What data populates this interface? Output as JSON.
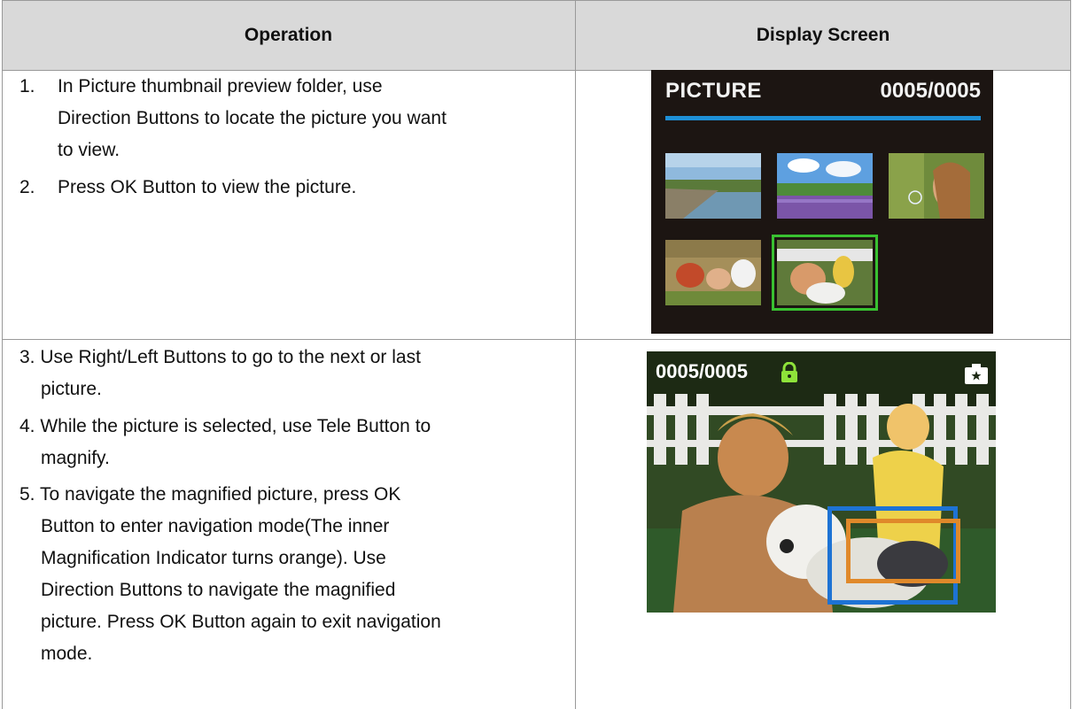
{
  "table": {
    "headers": {
      "operation": "Operation",
      "display": "Display Screen"
    },
    "row1": {
      "steps": [
        {
          "num": "1.",
          "lines": [
            "In Picture thumbnail preview folder, use",
            "Direction Buttons to locate the picture you want",
            "to view."
          ]
        },
        {
          "num": "2.",
          "lines": [
            "Press OK Button to view the picture."
          ]
        }
      ]
    },
    "row2": {
      "steps": [
        {
          "lines": [
            "3. Use Right/Left Buttons to go to the next or last",
            "picture."
          ]
        },
        {
          "lines": [
            "4. While the picture is selected, use Tele Button to",
            "magnify."
          ]
        },
        {
          "lines": [
            "5. To navigate the magnified picture, press OK",
            "Button to enter navigation mode(The inner",
            "Magnification Indicator turns orange). Use",
            "Direction Buttons to navigate the magnified",
            "picture. Press OK Button again to exit navigation",
            "mode."
          ]
        }
      ]
    }
  },
  "screen1": {
    "title": "PICTURE",
    "counter": "0005/0005",
    "accent": "#1e8fd6",
    "selection_color": "#39c131",
    "thumbnails": [
      "landscape-pier",
      "lavender-field",
      "girl-blowing-bubbles",
      "family-picnic",
      "father-and-child-with-dog"
    ],
    "selected_index": 4
  },
  "screen2": {
    "counter": "0005/0005",
    "lock_icon": "lock-icon",
    "camera_icon": "camera-icon",
    "outer_indicator_color": "#1e73d4",
    "inner_indicator_color": "#e0892a"
  }
}
